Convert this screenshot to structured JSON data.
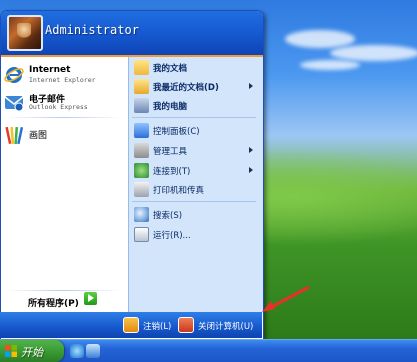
{
  "user": {
    "name": "Administrator"
  },
  "pinned": [
    {
      "title": "Internet",
      "subtitle": "Internet Explorer",
      "icon": "ie-icon"
    },
    {
      "title": "电子邮件",
      "subtitle": "Outlook Express",
      "icon": "outlook-express-icon"
    }
  ],
  "recent": [
    {
      "title": "画图",
      "icon": "paint-icon"
    }
  ],
  "all_programs": "所有程序(P)",
  "right_items": [
    {
      "label": "我的文档",
      "icon": "folder-documents-icon",
      "bold": true,
      "arrow": false
    },
    {
      "label": "我最近的文档(D)",
      "icon": "folder-recent-icon",
      "bold": true,
      "arrow": true
    },
    {
      "label": "我的电脑",
      "icon": "computer-icon",
      "bold": true,
      "arrow": false
    },
    {
      "label": "控制面板(C)",
      "icon": "control-panel-icon",
      "bold": false,
      "arrow": false
    },
    {
      "label": "管理工具",
      "icon": "admin-tools-icon",
      "bold": false,
      "arrow": true
    },
    {
      "label": "连接到(T)",
      "icon": "connect-icon",
      "bold": false,
      "arrow": true
    },
    {
      "label": "打印机和传真",
      "icon": "printer-icon",
      "bold": false,
      "arrow": false
    },
    {
      "label": "搜索(S)",
      "icon": "search-icon",
      "bold": false,
      "arrow": false
    },
    {
      "label": "运行(R)...",
      "icon": "run-icon",
      "bold": false,
      "arrow": false
    }
  ],
  "footer": {
    "logoff": "注销(L)",
    "shutdown": "关闭计算机(U)"
  },
  "taskbar": {
    "start_label": "开始"
  },
  "colors": {
    "header_blue": "#1557cf",
    "right_pane": "#d3e5fa",
    "footer_blue": "#1657cc",
    "start_green": "#399a33",
    "annotation_red": "#e8302a"
  }
}
